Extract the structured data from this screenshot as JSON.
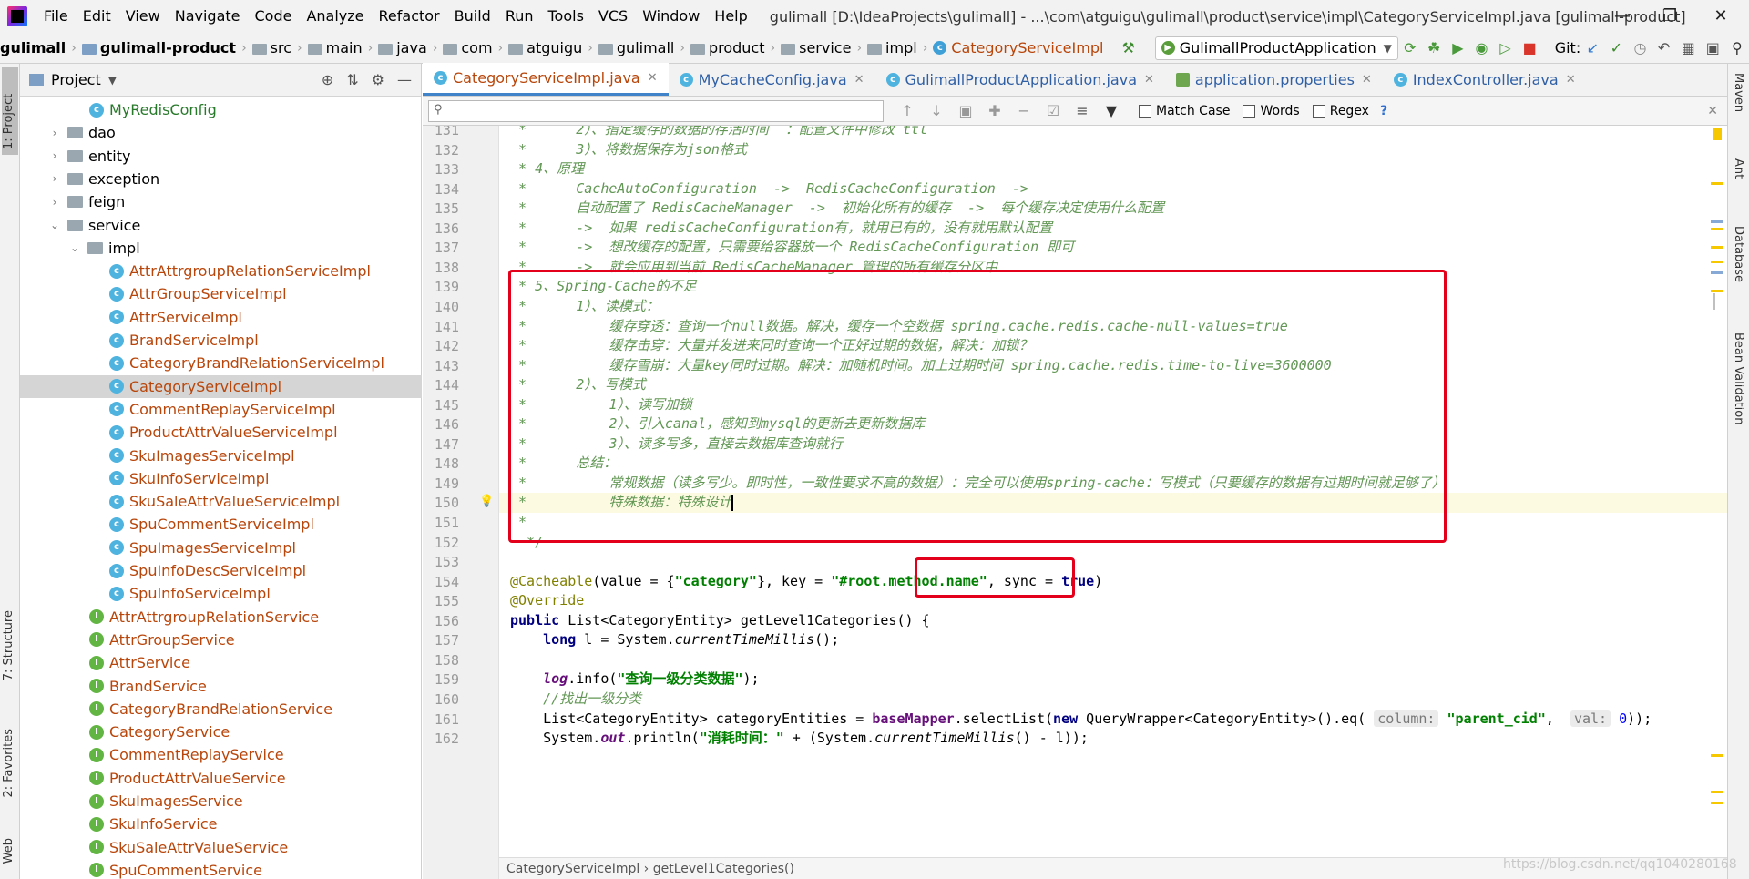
{
  "menu": [
    "File",
    "Edit",
    "View",
    "Navigate",
    "Code",
    "Analyze",
    "Refactor",
    "Build",
    "Run",
    "Tools",
    "VCS",
    "Window",
    "Help"
  ],
  "window_title": "gulimall [D:\\IdeaProjects\\gulimall] - ...\\com\\atguigu\\gulimall\\product\\service\\impl\\CategoryServiceImpl.java [gulimall-product]",
  "nav": {
    "crumbs": [
      "gulimall",
      "gulimall-product",
      "src",
      "main",
      "java",
      "com",
      "atguigu",
      "gulimall",
      "product",
      "service",
      "impl",
      "CategoryServiceImpl"
    ],
    "run_config": "GulimallProductApplication",
    "git_label": "Git:"
  },
  "left_stripe": {
    "project": "1: Project",
    "structure": "7: Structure",
    "favorites": "2: Favorites",
    "web": "Web"
  },
  "right_stripe": {
    "maven": "Maven",
    "ant": "Ant",
    "database": "Database",
    "bean": "Bean Validation"
  },
  "project_panel": {
    "title": "Project",
    "tree": [
      {
        "label": "MyRedisConfig",
        "kind": "class-green",
        "indent": 3
      },
      {
        "label": "dao",
        "kind": "folder",
        "indent": 1
      },
      {
        "label": "entity",
        "kind": "folder",
        "indent": 1
      },
      {
        "label": "exception",
        "kind": "folder",
        "indent": 1
      },
      {
        "label": "feign",
        "kind": "folder",
        "indent": 1
      },
      {
        "label": "service",
        "kind": "folder-open",
        "indent": 1
      },
      {
        "label": "impl",
        "kind": "folder-open",
        "indent": 2
      },
      {
        "label": "AttrAttrgroupRelationServiceImpl",
        "kind": "class",
        "indent": 4
      },
      {
        "label": "AttrGroupServiceImpl",
        "kind": "class",
        "indent": 4
      },
      {
        "label": "AttrServiceImpl",
        "kind": "class",
        "indent": 4
      },
      {
        "label": "BrandServiceImpl",
        "kind": "class",
        "indent": 4
      },
      {
        "label": "CategoryBrandRelationServiceImpl",
        "kind": "class",
        "indent": 4
      },
      {
        "label": "CategoryServiceImpl",
        "kind": "class",
        "indent": 4,
        "selected": true
      },
      {
        "label": "CommentReplayServiceImpl",
        "kind": "class",
        "indent": 4
      },
      {
        "label": "ProductAttrValueServiceImpl",
        "kind": "class",
        "indent": 4
      },
      {
        "label": "SkuImagesServiceImpl",
        "kind": "class",
        "indent": 4
      },
      {
        "label": "SkuInfoServiceImpl",
        "kind": "class",
        "indent": 4
      },
      {
        "label": "SkuSaleAttrValueServiceImpl",
        "kind": "class",
        "indent": 4
      },
      {
        "label": "SpuCommentServiceImpl",
        "kind": "class",
        "indent": 4
      },
      {
        "label": "SpuImagesServiceImpl",
        "kind": "class",
        "indent": 4
      },
      {
        "label": "SpuInfoDescServiceImpl",
        "kind": "class",
        "indent": 4
      },
      {
        "label": "SpuInfoServiceImpl",
        "kind": "class",
        "indent": 4
      },
      {
        "label": "AttrAttrgroupRelationService",
        "kind": "iface",
        "indent": 3
      },
      {
        "label": "AttrGroupService",
        "kind": "iface",
        "indent": 3
      },
      {
        "label": "AttrService",
        "kind": "iface",
        "indent": 3
      },
      {
        "label": "BrandService",
        "kind": "iface",
        "indent": 3
      },
      {
        "label": "CategoryBrandRelationService",
        "kind": "iface",
        "indent": 3
      },
      {
        "label": "CategoryService",
        "kind": "iface",
        "indent": 3
      },
      {
        "label": "CommentReplayService",
        "kind": "iface",
        "indent": 3
      },
      {
        "label": "ProductAttrValueService",
        "kind": "iface",
        "indent": 3
      },
      {
        "label": "SkuImagesService",
        "kind": "iface",
        "indent": 3
      },
      {
        "label": "SkuInfoService",
        "kind": "iface",
        "indent": 3
      },
      {
        "label": "SkuSaleAttrValueService",
        "kind": "iface",
        "indent": 3
      },
      {
        "label": "SpuCommentService",
        "kind": "iface",
        "indent": 3
      }
    ]
  },
  "tabs": [
    {
      "label": "CategoryServiceImpl.java",
      "active": true,
      "icon": "c"
    },
    {
      "label": "MyCacheConfig.java",
      "active": false,
      "icon": "c"
    },
    {
      "label": "GulimallProductApplication.java",
      "active": false,
      "icon": "c"
    },
    {
      "label": "application.properties",
      "active": false,
      "icon": "props"
    },
    {
      "label": "IndexController.java",
      "active": false,
      "icon": "c"
    }
  ],
  "find": {
    "placeholder": "",
    "match_case": "Match Case",
    "words": "Words",
    "regex": "Regex",
    "help": "?"
  },
  "code": {
    "lines": [
      {
        "n": "131",
        "html": "<span class='cmt'> *      2）、指定缓存的数据的存活时间  ：配置文件中修改 ttl</span>"
      },
      {
        "n": "132",
        "html": "<span class='cmt'> *      3）、将数据保存为json格式</span>"
      },
      {
        "n": "133",
        "html": "<span class='cmt'> * 4、原理</span>"
      },
      {
        "n": "134",
        "html": "<span class='cmt'> *      CacheAutoConfiguration  -&gt;  RedisCacheConfiguration  -&gt;</span>"
      },
      {
        "n": "135",
        "html": "<span class='cmt'> *      自动配置了 RedisCacheManager  -&gt;  初始化所有的缓存  -&gt;  每个缓存决定使用什么配置</span>"
      },
      {
        "n": "136",
        "html": "<span class='cmt'> *      -&gt;  如果 redisCacheConfiguration有，就用已有的，没有就用默认配置</span>"
      },
      {
        "n": "137",
        "html": "<span class='cmt'> *      -&gt;  想改缓存的配置，只需要给容器放一个 RedisCacheConfiguration 即可</span>"
      },
      {
        "n": "138",
        "html": "<span class='cmt'> *      -&gt;  就会应用到当前 RedisCacheManager 管理的所有缓存分区中</span>"
      },
      {
        "n": "139",
        "html": "<span class='cmt'> * 5、Spring-Cache的不足</span>"
      },
      {
        "n": "140",
        "html": "<span class='cmt'> *      1）、读模式：</span>"
      },
      {
        "n": "141",
        "html": "<span class='cmt'> *          缓存穿透：查询一个null数据。解决，缓存一个空数据 spring.cache.redis.cache-null-values=true</span>"
      },
      {
        "n": "142",
        "html": "<span class='cmt'> *          缓存击穿：大量并发进来同时查询一个正好过期的数据，解决：加锁？</span>"
      },
      {
        "n": "143",
        "html": "<span class='cmt'> *          缓存雪崩：大量key同时过期。解决：加随机时间。加上过期时间 spring.cache.redis.time-to-live=3600000</span>"
      },
      {
        "n": "144",
        "html": "<span class='cmt'> *      2）、写模式</span>"
      },
      {
        "n": "145",
        "html": "<span class='cmt'> *          1）、读写加锁</span>"
      },
      {
        "n": "146",
        "html": "<span class='cmt'> *          2）、引入canal，感知到mysql的更新去更新数据库</span>"
      },
      {
        "n": "147",
        "html": "<span class='cmt'> *          3）、读多写多，直接去数据库查询就行</span>"
      },
      {
        "n": "148",
        "html": "<span class='cmt'> *      总结：</span>"
      },
      {
        "n": "149",
        "html": "<span class='cmt'> *          常规数据（读多写少。即时性，一致性要求不高的数据）：完全可以使用spring-cache：写模式（只要缓存的数据有过期时间就足够了）</span>"
      },
      {
        "n": "150",
        "html": "<span class='cmt'> *          特殊数据：特殊设计</span><span class='caret'></span>",
        "current": true
      },
      {
        "n": "151",
        "html": "<span class='cmt'> *</span>"
      },
      {
        "n": "152",
        "html": "<span class='cmt'>  */</span>"
      },
      {
        "n": "153",
        "html": ""
      },
      {
        "n": "154",
        "html": "<span class='ann'>@Cacheable</span>(value = {<span class='str'>\"category\"</span>}, key = <span class='str'>\"#root.method.name\"</span>, sync = <span class='kw'>true</span>)"
      },
      {
        "n": "155",
        "html": "<span class='ann'>@Override</span>"
      },
      {
        "n": "156",
        "html": "<span class='kw'>public</span> List&lt;CategoryEntity&gt; getLevel1Categories() {"
      },
      {
        "n": "157",
        "html": "    <span class='kw'>long</span> l = System.<i>currentTimeMillis</i>();"
      },
      {
        "n": "158",
        "html": ""
      },
      {
        "n": "159",
        "html": "    <span class='fld'>log</span>.info(<span class='str'>\"查询一级分类数据\"</span>);"
      },
      {
        "n": "160",
        "html": "    <span class='cmt'>//找出一级分类</span>"
      },
      {
        "n": "161",
        "html": "    List&lt;CategoryEntity&gt; categoryEntities = <span class='fld' style='color:#660e7a;font-style:normal'>baseMapper</span>.selectList(<span class='kw'>new</span> QueryWrapper&lt;CategoryEntity&gt;().eq( <span class='hint'>column:</span> <span class='str'>\"parent_cid\"</span>,  <span class='hint'>val:</span> <span class='num'>0</span>));"
      },
      {
        "n": "162",
        "html": "    System.<span class='fld'>out</span>.println(<span class='str'>\"消耗时间：\"</span> + (System.<i>currentTimeMillis</i>() - l));"
      }
    ],
    "bottom_breadcrumb": "CategoryServiceImpl  ›  getLevel1Categories()"
  },
  "watermark": "https://blog.csdn.net/qq1040280168"
}
